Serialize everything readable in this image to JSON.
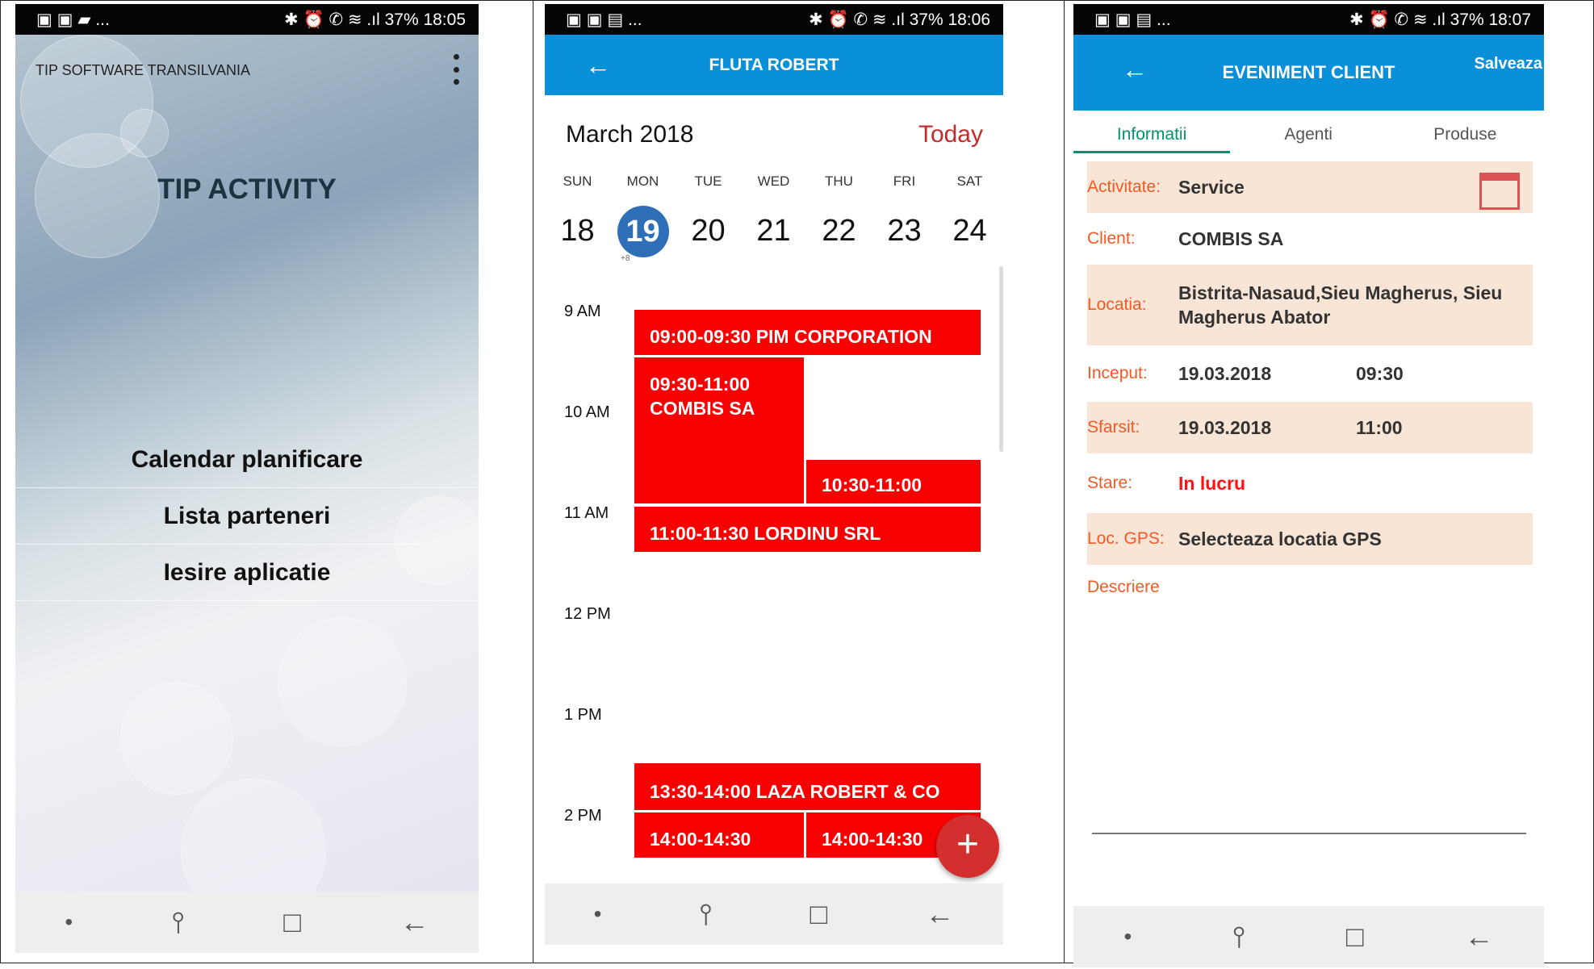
{
  "status_bars": [
    {
      "left": "▣ ▣ ▰ ...",
      "right": "✱ ⏰ ✆ ≋  .ıl 37% 18:05"
    },
    {
      "left": "▣ ▣ ▤ ...",
      "right": "✱ ⏰ ✆ ≋  .ıl 37% 18:06"
    },
    {
      "left": "▣ ▣ ▤ ...",
      "right": "✱ ⏰ ✆ ≋  .ıl 37% 18:07"
    }
  ],
  "screen1": {
    "owner": "TIP SOFTWARE TRANSILVANIA",
    "title": "TIP ACTIVITY",
    "menu": [
      "Calendar planificare",
      "Lista parteneri",
      "Iesire aplicatie"
    ]
  },
  "screen2": {
    "appbar_title": "FLUTA ROBERT",
    "month": "March 2018",
    "today": "Today",
    "weekdays": [
      "SUN",
      "MON",
      "TUE",
      "WED",
      "THU",
      "FRI",
      "SAT"
    ],
    "dates": [
      "18",
      "19",
      "20",
      "21",
      "22",
      "23",
      "24"
    ],
    "selected_badge": "+8",
    "hours": [
      "9 AM",
      "10 AM",
      "11 AM",
      "12 PM",
      "1 PM",
      "2 PM"
    ],
    "events": [
      "09:00-09:30 PIM CORPORATION",
      "09:30-11:00\nCOMBIS SA",
      "10:30-11:00",
      "11:00-11:30 LORDINU SRL",
      "13:30-14:00 LAZA ROBERT & CO",
      "14:00-14:30",
      "14:00-14:30"
    ],
    "fab": "+"
  },
  "screen3": {
    "appbar_title": "EVENIMENT CLIENT",
    "save": "Salveaza",
    "tabs": [
      "Informatii",
      "Agenti",
      "Produse"
    ],
    "fields": {
      "activitate_label": "Activitate:",
      "activitate_value": "Service",
      "client_label": "Client:",
      "client_value": "COMBIS SA",
      "locatia_label": "Locatia:",
      "locatia_value": "Bistrita-Nasaud,Sieu Magherus, Sieu Magherus Abator",
      "inceput_label": "Inceput:",
      "inceput_date": "19.03.2018",
      "inceput_time": "09:30",
      "sfarsit_label": "Sfarsit:",
      "sfarsit_date": "19.03.2018",
      "sfarsit_time": "11:00",
      "stare_label": "Stare:",
      "stare_value": "In lucru",
      "gps_label": "Loc. GPS:",
      "gps_value": "Selecteaza locatia GPS",
      "description_label": "Descriere"
    }
  },
  "navbar": {
    "dot": "•",
    "recent": "⫯",
    "home": "□",
    "back": "←"
  },
  "colors": {
    "primary": "#0a90d8",
    "event": "#f90000",
    "accent": "#f15a24",
    "selected": "#2f6fb8"
  }
}
